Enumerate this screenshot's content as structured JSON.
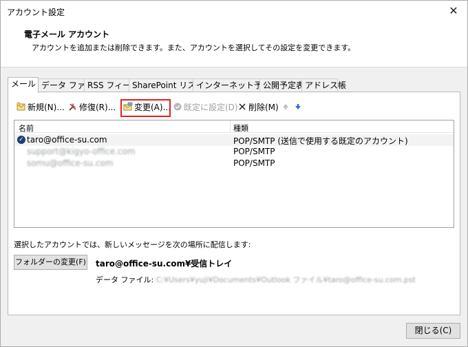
{
  "window": {
    "title": "アカウント設定",
    "close_glyph": "✕"
  },
  "header": {
    "title": "電子メール アカウント",
    "subtitle": "アカウントを追加または削除できます。また、アカウントを選択してその設定を変更できます。"
  },
  "tabs": [
    {
      "label": "メール",
      "active": true
    },
    {
      "label": "データ ファイル"
    },
    {
      "label": "RSS フィード"
    },
    {
      "label": "SharePoint リスト"
    },
    {
      "label": "インターネット予定表"
    },
    {
      "label": "公開予定表"
    },
    {
      "label": "アドレス帳"
    }
  ],
  "toolbar": {
    "new_label": "新規(N)...",
    "repair_label": "修復(R)...",
    "change_label": "変更(A)...",
    "default_label": "既定に設定(D)",
    "delete_label": "削除(M)",
    "icons": {
      "new": "new-account-icon",
      "repair": "repair-tools-icon",
      "change": "change-settings-icon",
      "default": "check-circle-icon",
      "delete": "delete-x-icon",
      "up": "move-up-arrow-icon",
      "down": "move-down-arrow-icon"
    }
  },
  "accounts": {
    "columns": [
      "名前",
      "種類"
    ],
    "rows": [
      {
        "name": "taro@office-su.com",
        "type": "POP/SMTP (送信で使用する既定のアカウント)",
        "default": true
      },
      {
        "name": "support@kigyo-office.com",
        "type": "POP/SMTP",
        "default": false
      },
      {
        "name": "somu@office-su.com",
        "type": "POP/SMTP",
        "default": false
      }
    ]
  },
  "delivery": {
    "text": "選択したアカウントでは、新しいメッセージを次の場所に配信します:",
    "folder_button": "フォルダーの変更(F)",
    "folder_path": "taro@office-su.com¥受信トレイ",
    "datafile_label": "データ ファイル:",
    "datafile_path": "C:¥Users¥yuji¥Documents¥Outlook ファイル¥taro@office-su.com.pst"
  },
  "footer": {
    "close_label": "閉じる(C)"
  },
  "colors": {
    "highlight_border": "#e02020",
    "default_check": "#1f3f6e"
  }
}
